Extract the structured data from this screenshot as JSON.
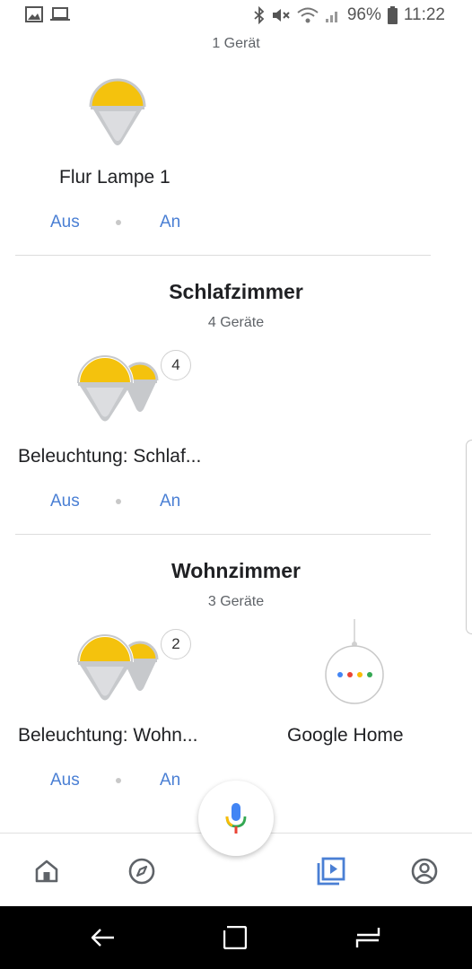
{
  "status": {
    "battery": "96%",
    "time": "11:22"
  },
  "rooms": [
    {
      "count": "1 Gerät",
      "devices": [
        {
          "name": "Flur Lampe 1",
          "off": "Aus",
          "on": "An"
        }
      ]
    },
    {
      "title": "Schlafzimmer",
      "count": "4 Geräte",
      "devices": [
        {
          "name": "Beleuchtung: Schlaf...",
          "badge": "4",
          "off": "Aus",
          "on": "An"
        }
      ]
    },
    {
      "title": "Wohnzimmer",
      "count": "3 Geräte",
      "devices": [
        {
          "name": "Beleuchtung: Wohn...",
          "badge": "2",
          "off": "Aus",
          "on": "An"
        },
        {
          "name": "Google Home"
        }
      ]
    }
  ],
  "colors": {
    "accent": "#4a7fd4",
    "bulb": "#f4c20d",
    "bulb_body": "#c7c9cc"
  },
  "icons": {
    "bottom_nav": [
      "home-icon",
      "explore-icon",
      "media-icon",
      "account-icon"
    ],
    "system_nav": [
      "back-icon",
      "recents-icon",
      "overview-icon"
    ]
  }
}
